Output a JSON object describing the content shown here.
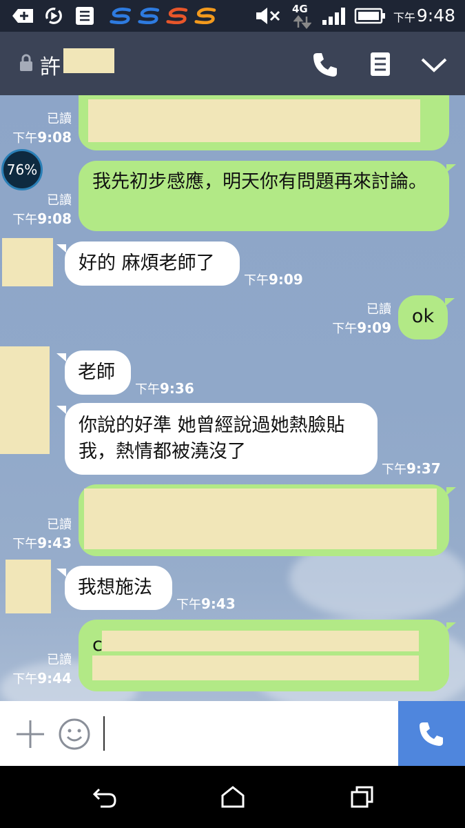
{
  "status_bar": {
    "time_prefix": "下午",
    "time": "9:48",
    "network": "4G"
  },
  "header": {
    "title": "許"
  },
  "messages": [
    {
      "side": "me",
      "read": "已讀",
      "time_prefix": "下午",
      "time": "9:08",
      "text": ""
    },
    {
      "side": "me",
      "read": "已讀",
      "time_prefix": "下午",
      "time": "9:08",
      "text": "我先初步感應，明天你有問題再來討論。"
    },
    {
      "side": "them",
      "time_prefix": "下午",
      "time": "9:09",
      "text": "好的 麻煩老師了"
    },
    {
      "side": "me",
      "read": "已讀",
      "time_prefix": "下午",
      "time": "9:09",
      "text": "ok"
    },
    {
      "side": "them",
      "time_prefix": "下午",
      "time": "9:36",
      "text": "老師"
    },
    {
      "side": "them",
      "time_prefix": "下午",
      "time": "9:37",
      "text": "你說的好準 她曾經說過她熱臉貼我，熱情都被澆沒了"
    },
    {
      "side": "me",
      "read": "已讀",
      "time_prefix": "下午",
      "time": "9:43",
      "text": ""
    },
    {
      "side": "them",
      "time_prefix": "下午",
      "time": "9:43",
      "text": "我想施法"
    },
    {
      "side": "me",
      "read": "已讀",
      "time_prefix": "下午",
      "time": "9:44",
      "text": "c"
    }
  ],
  "badge": "76%",
  "colors": {
    "my_bubble": "#b2e986",
    "their_bubble": "#ffffff",
    "header": "#3b4356",
    "call_button": "#4f86dd"
  },
  "icons": {
    "header": [
      "lock-icon",
      "phone-icon",
      "notes-icon",
      "chevron-down-icon"
    ],
    "input": [
      "plus-icon",
      "emoji-icon",
      "phone-icon"
    ],
    "nav": [
      "back-icon",
      "home-icon",
      "recents-icon"
    ]
  }
}
